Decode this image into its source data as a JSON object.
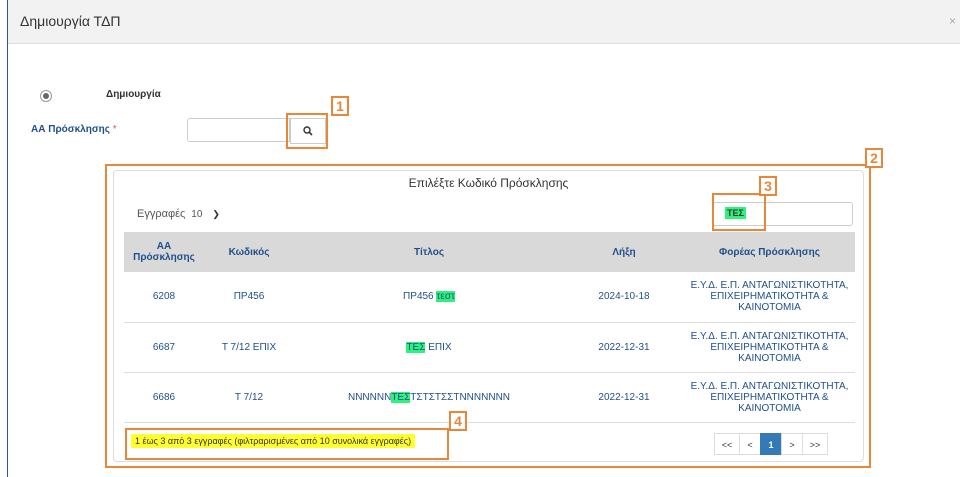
{
  "header": {
    "title": "Δημιουργία ΤΔΠ",
    "close_label": "×"
  },
  "form": {
    "radio_label": "Δημιουργία",
    "aa_label": "ΑΑ Πρόσκλησης",
    "required_mark": "*",
    "aa_value": ""
  },
  "panel": {
    "title": "Επιλέξτε Κωδικό Πρόσκλησης",
    "entries_label": "Εγγραφές",
    "entries_value": "10",
    "filter_value": "ΤΕΣ",
    "columns": [
      "ΑΑ Πρόσκλησης",
      "Κωδικός",
      "Τίτλος",
      "Λήξη",
      "Φορέας Πρόσκλησης"
    ],
    "rows": [
      {
        "aa": "6208",
        "code": "ΠΡ456",
        "title_pre": "ΠΡ456 ",
        "title_hl": "τεστ",
        "title_post": "",
        "expiry": "2024-10-18",
        "body": "Ε.Υ.Δ. Ε.Π. ΑΝΤΑΓΩΝΙΣΤΙΚΟΤΗΤΑ, ΕΠΙΧΕΙΡΗΜΑΤΙΚΟΤΗΤΑ & ΚΑΙΝΟΤΟΜΙΑ"
      },
      {
        "aa": "6687",
        "code": "Τ 7/12 ΕΠΙΧ",
        "title_pre": "",
        "title_hl": "ΤΕΣ",
        "title_post": " ΕΠΙΧ",
        "expiry": "2022-12-31",
        "body": "Ε.Υ.Δ. Ε.Π. ΑΝΤΑΓΩΝΙΣΤΙΚΟΤΗΤΑ, ΕΠΙΧΕΙΡΗΜΑΤΙΚΟΤΗΤΑ & ΚΑΙΝΟΤΟΜΙΑ"
      },
      {
        "aa": "6686",
        "code": "Τ 7/12",
        "title_pre": "ΝΝΝΝΝΝ",
        "title_hl": "ΤΕΣ",
        "title_post": "ΤΣΤΣΤΣΣΤΝΝΝΝΝΝΝ",
        "expiry": "2022-12-31",
        "body": "Ε.Υ.Δ. Ε.Π. ΑΝΤΑΓΩΝΙΣΤΙΚΟΤΗΤΑ, ΕΠΙΧΕΙΡΗΜΑΤΙΚΟΤΗΤΑ & ΚΑΙΝΟΤΟΜΙΑ"
      }
    ],
    "info": "1 έως 3 από 3 εγγραφές (φιλτραρισμένες από 10 συνολικά εγγραφές)",
    "pager": {
      "first": "<<",
      "prev": "<",
      "current": "1",
      "next": ">",
      "last": ">>"
    }
  },
  "callouts": [
    "1",
    "2",
    "3",
    "4"
  ],
  "icons": {
    "search": "search-icon",
    "dropdown": "chevron-down-icon"
  },
  "colors": {
    "accent": "#e8873a",
    "highlight": "#2ef27a",
    "info_bg": "#ffff30",
    "link": "#1f4e8c",
    "pager_active": "#337ab7"
  }
}
